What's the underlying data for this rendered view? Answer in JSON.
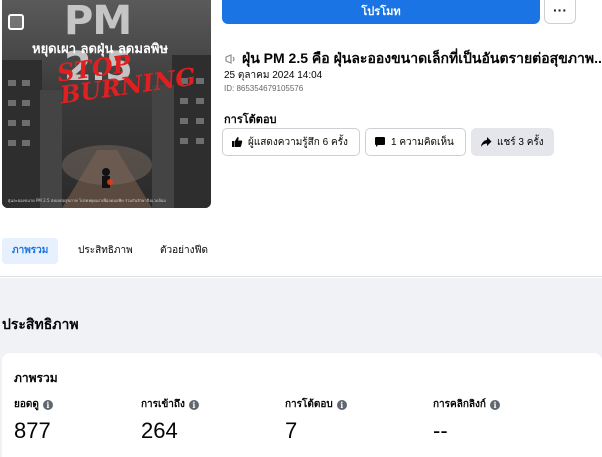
{
  "thumbnail": {
    "pm_text": "PM 2.5",
    "headline": "หยุดเผา ลดฝุ่น ลดมลพิษ",
    "stop_text": "STOP BURNING",
    "caption": "ฝุ่นละอองขนาด PM 2.5 ส่งผลต่อสุขภาพ โปรดหยุดเผาเพื่อลดมลพิษ ร่วมกันรักษาสิ่งแวดล้อม"
  },
  "toolbar": {
    "promote_label": "โปรโมท",
    "more_label": "···"
  },
  "post": {
    "title": "ฝุ่น PM 2.5 คือ ฝุ่นละอองขนาดเล็กที่เป็นอันตรายต่อสุขภาพ...",
    "date": "25 ตุลาคม 2024 14:04",
    "id_text": "ID: 865354679105576"
  },
  "responses": {
    "label": "การโต้ตอบ",
    "reactions_label": "ผู้แสดงความรู้สึก 6 ครั้ง",
    "comments_label": "1 ความคิดเห็น",
    "shares_label": "แชร์ 3 ครั้ง"
  },
  "tabs": [
    {
      "label": "ภาพรวม",
      "active": true
    },
    {
      "label": "ประสิทธิภาพ",
      "active": false
    },
    {
      "label": "ตัวอย่างฟีด",
      "active": false
    }
  ],
  "performance": {
    "section_title": "ประสิทธิภาพ",
    "card_title": "ภาพรวม",
    "metrics": [
      {
        "label": "ยอดดู",
        "value": "877"
      },
      {
        "label": "การเข้าถึง",
        "value": "264"
      },
      {
        "label": "การโต้ตอบ",
        "value": "7"
      },
      {
        "label": "การคลิกลิงก์",
        "value": "--"
      }
    ]
  },
  "colors": {
    "accent": "#1b74e4",
    "page_bg": "#f0f2f5",
    "tab_active_bg": "#e7f0fd"
  }
}
